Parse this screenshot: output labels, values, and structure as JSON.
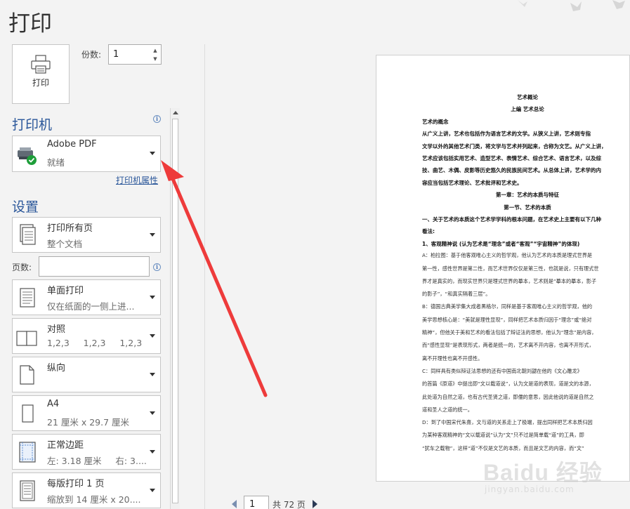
{
  "header": {
    "title": "打印"
  },
  "print_button": {
    "label": "打印"
  },
  "copies": {
    "label": "份数:",
    "value": "1"
  },
  "printer": {
    "heading": "打印机",
    "name": "Adobe PDF",
    "status": "就绪",
    "properties_link": "打印机属性"
  },
  "settings": {
    "heading": "设置",
    "pages_label": "页数:",
    "pages_value": "",
    "dropdowns": [
      {
        "line1": "打印所有页",
        "line2": "整个文档",
        "icon": "pages-icon"
      },
      {
        "line1": "单面打印",
        "line2": "仅在纸面的一侧上进...",
        "icon": "one-sided-icon"
      },
      {
        "line1": "对照",
        "line2": "1,2,3     1,2,3     1,2,3",
        "icon": "collate-icon"
      },
      {
        "line1": "纵向",
        "line2": "",
        "icon": "portrait-icon"
      },
      {
        "line1": "A4",
        "line2": "21 厘米 x 29.7 厘米",
        "icon": "paper-size-icon"
      },
      {
        "line1": "正常边距",
        "line2": "左: 3.18 厘米     右: 3....",
        "icon": "margins-icon"
      },
      {
        "line1": "每版打印 1 页",
        "line2": "缩放到 14 厘米 x 20....",
        "icon": "pages-per-sheet-icon"
      }
    ]
  },
  "preview": {
    "lines": [
      {
        "text": "艺术概论",
        "style": "b",
        "center": true
      },
      {
        "text": "上编  艺术总论",
        "style": "b",
        "center": true
      },
      {
        "text": "艺术的概念",
        "style": "b"
      },
      {
        "text": "    从广义上讲，艺术也包括作为语言艺术的文学。从狭义上讲，艺术则专指",
        "style": "b"
      },
      {
        "text": "文学以外的其他艺术门类，将文学与艺术并列起来，合称为文艺。从广义上讲，",
        "style": "b"
      },
      {
        "text": "艺术应该包括实用艺术、造型艺术、表情艺术、综合艺术、语言艺术，以及综",
        "style": "b"
      },
      {
        "text": "技、曲艺、木偶、皮影等历史悠久的民族民间艺术。从总体上讲，艺术学的内",
        "style": "b"
      },
      {
        "text": "容应当包括艺术理论、艺术批评和艺术史。",
        "style": "b"
      },
      {
        "text": "第一章：艺术的本质与特征",
        "style": "b",
        "center": true
      },
      {
        "text": "第一节、艺术的本质",
        "style": "b",
        "center": true
      },
      {
        "text": "一、关于艺术的本质这个艺术学学科的根本问题，在艺术史上主要有以下几种",
        "style": "b"
      },
      {
        "text": "看法:",
        "style": "b"
      },
      {
        "text": "1、客观精神说  (认为艺术是“理念”或者“客观”“宇宙精神”的体现)",
        "style": "b"
      },
      {
        "text": "    A：柏拉图：基于他客观唯心主义的哲学观，他认为艺术的本质是理式世界是",
        "style": "n"
      },
      {
        "text": "第一性，感性世界是第二性，而艺术世界仅仅是第三性，也就是说，只有理式世",
        "style": "n"
      },
      {
        "text": "界才是真实的，而现实世界只是理式世界的摹本，艺术则是“摹本的摹本，影子",
        "style": "n"
      },
      {
        "text": "的影子”，“和真实隔着三层”。",
        "style": "n"
      },
      {
        "text": "    B：德国古典美学集大成者黑格尔，同样是基于客观唯心主义的哲学观，他的",
        "style": "n"
      },
      {
        "text": "美学思想核心是：“美就是理性显现”，同样把艺术本质归因于“理念”或“绝对",
        "style": "n"
      },
      {
        "text": "精神”，但他关于美和艺术的看法包括了辩证法的思想，他认为“理念”是内容，",
        "style": "n"
      },
      {
        "text": "而“感性显现”是表现形式，两者是统一的，艺术离不开内容，也离不开形式，",
        "style": "n"
      },
      {
        "text": "离不开理性也离不开感性。",
        "style": "n"
      },
      {
        "text": "    C：同样具有类似辩证法思想的还有中国南北朝刘勰在他的《文心雕龙》",
        "style": "n"
      },
      {
        "text": "的首篇《原道》中提出即“文以载道说”，认为文是道的表现，道是文的本源，",
        "style": "n"
      },
      {
        "text": "此处道为自然之道，也有古代圣贤之道，即儒的意思，因此他说的道是自然之",
        "style": "n"
      },
      {
        "text": "道和圣人之道的统一。",
        "style": "n"
      },
      {
        "text": "    D：到了中国宋代朱熹，文与道的关系走上了极端，提出同样把艺术本质归因",
        "style": "n"
      },
      {
        "text": "为某种客观精神的“文以载道说”认为“文”只不过是简单载“道”的工具，即",
        "style": "n"
      },
      {
        "text": "“犹车之载物”，这样“道”不仅是文艺的本质，而且是文艺的内容，而“文”",
        "style": "n"
      }
    ]
  },
  "pager": {
    "current": "1",
    "total_label": "共 72 页"
  },
  "watermark": {
    "text": "Baidu 经验",
    "sub": "jingyan.baidu.com"
  },
  "colors": {
    "accent": "#2b579a",
    "arrow": "#ee3b3b"
  }
}
